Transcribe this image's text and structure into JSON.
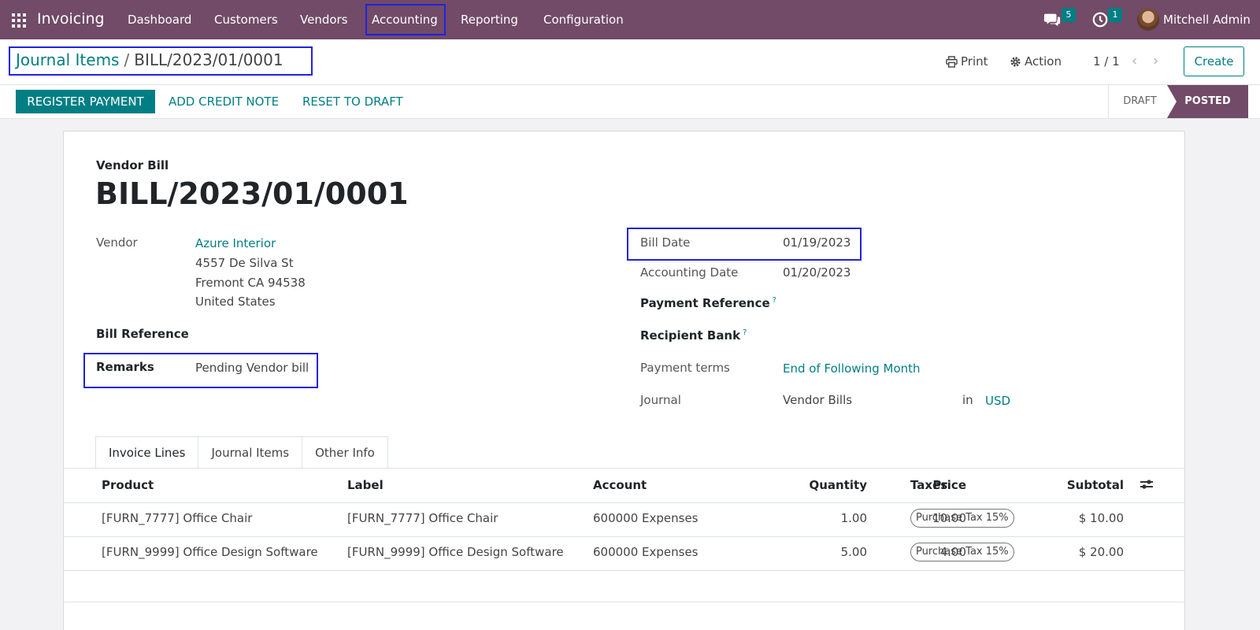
{
  "app": {
    "name": "Invoicing"
  },
  "nav": {
    "menu": [
      "Dashboard",
      "Customers",
      "Vendors",
      "Accounting",
      "Reporting",
      "Configuration"
    ],
    "messages_count": "5",
    "activities_count": "1",
    "user_name": "Mitchell Admin"
  },
  "breadcrumb": {
    "parent": "Journal Items",
    "separator": "/",
    "current": "BILL/2023/01/0001"
  },
  "control": {
    "print": "Print",
    "action": "Action",
    "pager": "1 / 1",
    "create": "Create"
  },
  "statusbar": {
    "buttons": [
      "REGISTER PAYMENT",
      "ADD CREDIT NOTE",
      "RESET TO DRAFT"
    ],
    "stages": [
      "DRAFT",
      "POSTED"
    ],
    "active_stage": "POSTED"
  },
  "form": {
    "type_label": "Vendor Bill",
    "title": "BILL/2023/01/0001",
    "vendor_label": "Vendor",
    "vendor_name": "Azure Interior",
    "vendor_address": [
      "4557 De Silva St",
      "Fremont CA 94538",
      "United States"
    ],
    "bill_reference_label": "Bill Reference",
    "remarks_label": "Remarks",
    "remarks_value": "Pending Vendor bill",
    "bill_date_label": "Bill Date",
    "bill_date_value": "01/19/2023",
    "accounting_date_label": "Accounting Date",
    "accounting_date_value": "01/20/2023",
    "payment_reference_label": "Payment Reference",
    "recipient_bank_label": "Recipient Bank",
    "tooltip_mark": "?",
    "payment_terms_label": "Payment terms",
    "payment_terms_value": "End of Following Month",
    "journal_label": "Journal",
    "journal_value": "Vendor Bills",
    "journal_in": "in",
    "currency": "USD"
  },
  "tabs": [
    "Invoice Lines",
    "Journal Items",
    "Other Info"
  ],
  "table": {
    "columns": [
      "Product",
      "Label",
      "Account",
      "Quantity",
      "Price",
      "Taxes",
      "Subtotal"
    ],
    "rows": [
      {
        "product": "[FURN_7777] Office Chair",
        "label": "[FURN_7777] Office Chair",
        "account": "600000 Expenses",
        "quantity": "1.00",
        "price": "10.00",
        "tax": "Purchase Tax 15%",
        "subtotal": "$ 10.00"
      },
      {
        "product": "[FURN_9999] Office Design Software",
        "label": "[FURN_9999] Office Design Software",
        "account": "600000 Expenses",
        "quantity": "5.00",
        "price": "4.00",
        "tax": "Purchase Tax 15%",
        "subtotal": "$ 20.00"
      }
    ]
  },
  "colors": {
    "brand": "#714b67",
    "accent": "#017e84",
    "highlight": "#2222dd"
  }
}
